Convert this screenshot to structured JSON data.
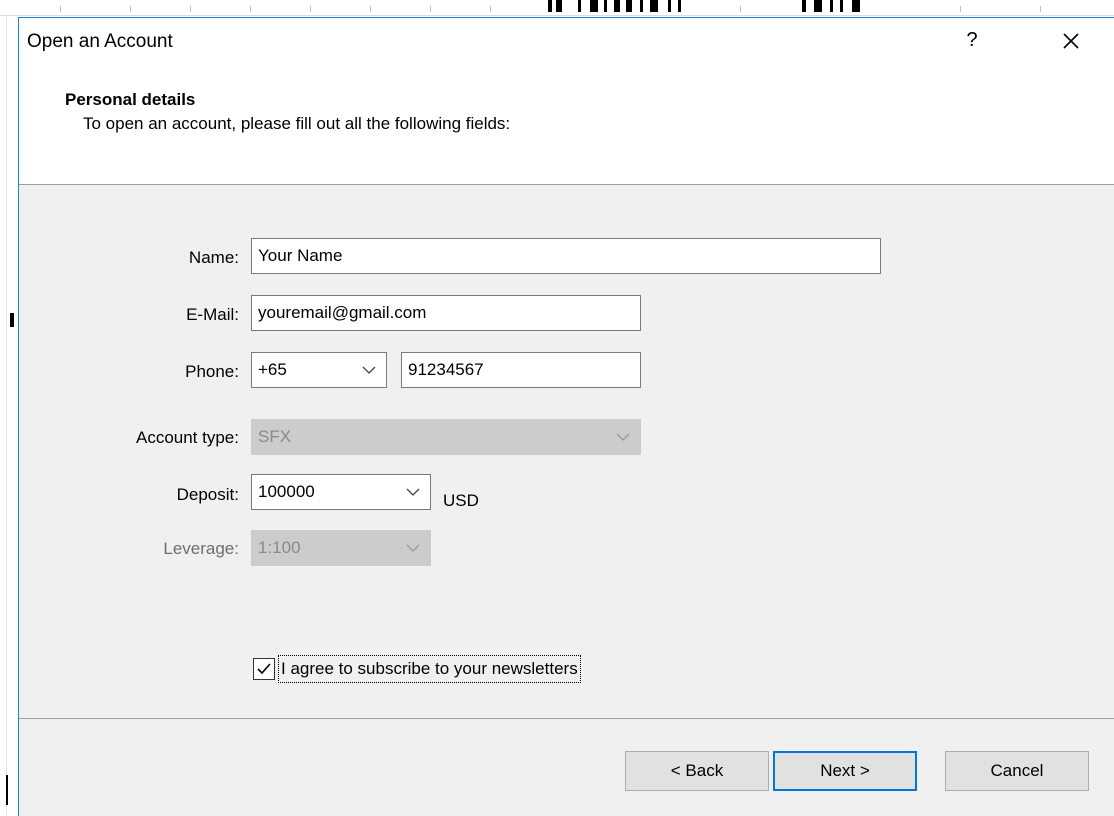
{
  "dialog": {
    "title": "Open an Account",
    "help_glyph": "?",
    "close_icon": "close-icon"
  },
  "header": {
    "title": "Personal details",
    "subtitle": "To open an account, please fill out all the following fields:"
  },
  "form": {
    "name": {
      "label": "Name:",
      "value": "Your Name"
    },
    "email": {
      "label": "E-Mail:",
      "value": "youremail@gmail.com"
    },
    "phone": {
      "label": "Phone:",
      "code": "+65",
      "number": "91234567"
    },
    "account_type": {
      "label": "Account type:",
      "value": "SFX",
      "enabled": false
    },
    "deposit": {
      "label": "Deposit:",
      "value": "100000",
      "currency": "USD"
    },
    "leverage": {
      "label": "Leverage:",
      "value": "1:100",
      "enabled": false
    }
  },
  "newsletter": {
    "checked": true,
    "label": "I agree to subscribe to your newsletters"
  },
  "buttons": {
    "back": "< Back",
    "next": "Next >",
    "cancel": "Cancel"
  },
  "colors": {
    "dialog_bg": "#f0f0f0",
    "accent": "#0078d7",
    "disabled_bg": "#cccccc"
  }
}
